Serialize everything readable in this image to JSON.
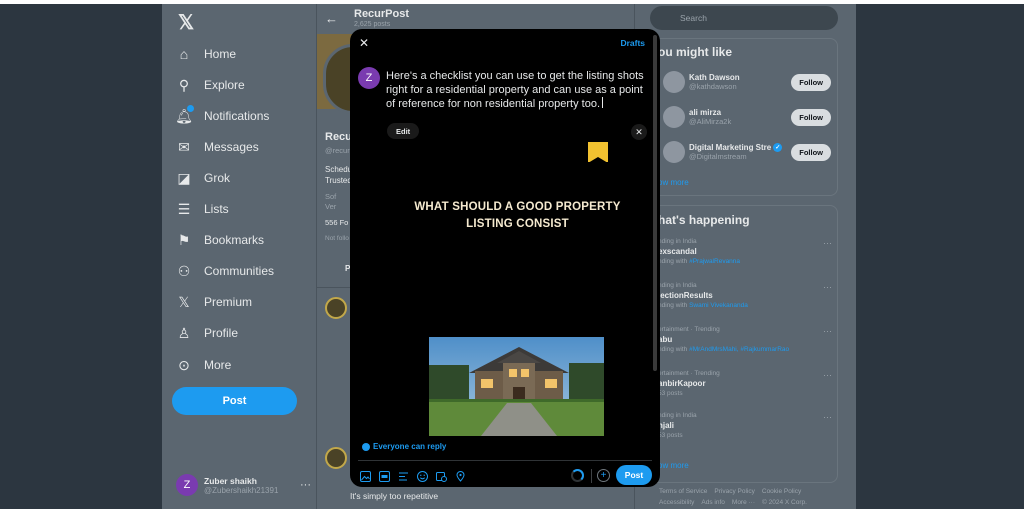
{
  "nav": {
    "items": [
      {
        "label": "Home",
        "icon": "home-icon",
        "glyph": "⌂"
      },
      {
        "label": "Explore",
        "icon": "search-icon",
        "glyph": "⚲"
      },
      {
        "label": "Notifications",
        "icon": "bell-icon",
        "glyph": "🔔︎"
      },
      {
        "label": "Messages",
        "icon": "mail-icon",
        "glyph": "✉"
      },
      {
        "label": "Grok",
        "icon": "grok-icon",
        "glyph": "◪"
      },
      {
        "label": "Lists",
        "icon": "list-icon",
        "glyph": "☰"
      },
      {
        "label": "Bookmarks",
        "icon": "bookmark-icon",
        "glyph": "⚑"
      },
      {
        "label": "Communities",
        "icon": "people-icon",
        "glyph": "⚇"
      },
      {
        "label": "Premium",
        "icon": "x-logo-icon",
        "glyph": "𝕏"
      },
      {
        "label": "Profile",
        "icon": "person-icon",
        "glyph": "♙"
      },
      {
        "label": "More",
        "icon": "more-circle-icon",
        "glyph": "⊙"
      }
    ],
    "post_label": "Post"
  },
  "user": {
    "initial": "Z",
    "name": "Zuber shaikh",
    "handle": "@Zubershaikh21391",
    "more": "···"
  },
  "profile": {
    "back": "←",
    "title": "RecurPost",
    "subtitle": "2,625 posts",
    "name": "Recu",
    "handle": "@recur",
    "bio1": "Schedu",
    "bio2": "Trusted",
    "meta1": "Sof",
    "meta2": "Ver",
    "count": "556 Fo",
    "followed_by": "Not follo",
    "tab": "P",
    "reply_text": "It's simply too repetitive"
  },
  "right": {
    "search_placeholder": "Search",
    "wtf_title": "ou might like",
    "suggestions": [
      {
        "name": "Kath Dawson",
        "handle": "@kathdawson",
        "verified": false,
        "follow": "Follow"
      },
      {
        "name": "ali mirza",
        "handle": "@AliMirza2k",
        "verified": false,
        "follow": "Follow"
      },
      {
        "name": "Digital Marketing Stre",
        "handle": "@Digitalmstream",
        "verified": true,
        "follow": "Follow"
      }
    ],
    "show_more": "ow more",
    "trends_title": "hat's happening",
    "trends": [
      {
        "category": "nding in India",
        "name": "exscandal",
        "sub_prefix": "nding with ",
        "sub_tag": "#PrajwalRevanna",
        "more": "···"
      },
      {
        "category": "nding in India",
        "name": "lectionResults",
        "sub_prefix": "nding with ",
        "sub_tag": "Swami Vivekananda",
        "more": "···"
      },
      {
        "category": "ertainment · Trending",
        "name": "abu",
        "sub_prefix": "nding with ",
        "sub_tag": "#MrAndMrsMahi, #RajkummarRao",
        "more": "···"
      },
      {
        "category": "ertainment · Trending",
        "name": "anbirKapoor",
        "sub_prefix": "53 posts",
        "sub_tag": "",
        "more": "···"
      },
      {
        "category": "nding in India",
        "name": "njali",
        "sub_prefix": "53 posts",
        "sub_tag": "",
        "more": "···"
      }
    ],
    "trends_show_more": "ow more",
    "footer1": [
      "Terms of Service",
      "Privacy Policy",
      "Cookie Policy"
    ],
    "footer2": [
      "Accessibility",
      "Ads info",
      "More ···",
      "© 2024 X Corp."
    ]
  },
  "modal": {
    "close": "✕",
    "drafts": "Drafts",
    "avatar_initial": "Z",
    "text": "Here's a checklist you can use to get the listing shots right for a residential property and can use as a point of reference for non residential property too.",
    "edit": "Edit",
    "remove": "✕",
    "headline": "WHAT SHOULD A GOOD PROPERTY LISTING CONSIST",
    "reply_setting": "Everyone can reply",
    "post_label": "Post",
    "add": "+",
    "tools": [
      "image-icon",
      "gif-icon",
      "poll-icon",
      "emoji-icon",
      "schedule-icon",
      "location-icon"
    ]
  },
  "colors": {
    "accent": "#1d9bf0",
    "bookmark": "#f2c230"
  }
}
